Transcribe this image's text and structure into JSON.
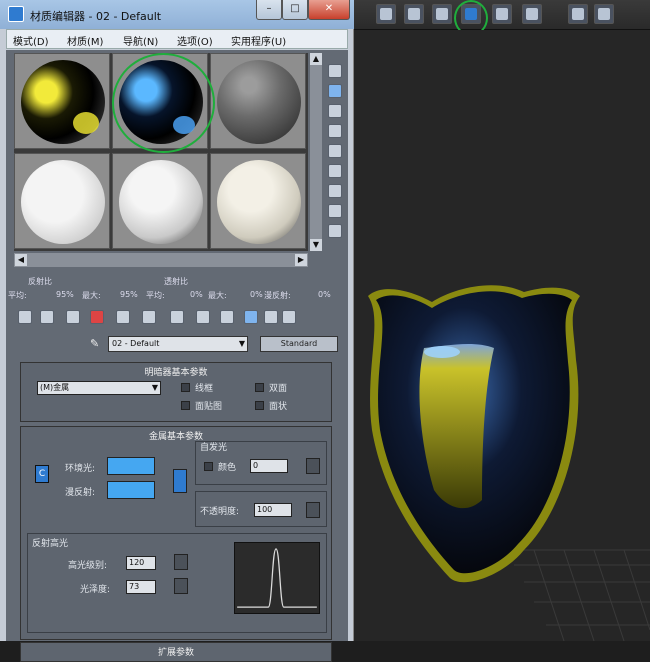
{
  "window": {
    "title": "材质编辑器 - 02 - Default",
    "minimize_label": "–",
    "maximize_label": "□",
    "close_label": "✕"
  },
  "menu": [
    {
      "label": "模式(D)"
    },
    {
      "label": "材质(M)"
    },
    {
      "label": "导航(N)"
    },
    {
      "label": "选项(O)"
    },
    {
      "label": "实用程序(U)"
    }
  ],
  "sample_slots": [
    {
      "material": "yellow-metal",
      "selected": false
    },
    {
      "material": "blue-metal",
      "selected": true
    },
    {
      "material": "gray",
      "selected": false
    },
    {
      "material": "white-glossy",
      "selected": false
    },
    {
      "material": "white-matte",
      "selected": false
    },
    {
      "material": "ivory",
      "selected": false
    }
  ],
  "params": {
    "reflect_label": "反射比",
    "refract_label": "透射比",
    "avg_label": "平均:",
    "max_label": "最大:",
    "reflect_avg": "95%",
    "reflect_max": "95%",
    "refract_avg": "0%",
    "refract_max": "0%",
    "diffuse_label": "漫反射:",
    "diffuse_value": "0%"
  },
  "material_row": {
    "material_name": "02 - Default",
    "type_button": "Standard"
  },
  "shader_panel": {
    "title": "明暗器基本参数",
    "shader": "(M)金属",
    "wire": "线框",
    "two_sided": "双面",
    "face_map": "面贴图",
    "faceted": "面状"
  },
  "metal_panel": {
    "title": "金属基本参数",
    "ambient": "环境光:",
    "diffuse": "漫反射:",
    "lock": "C",
    "self_illum": "自发光",
    "color": "颜色",
    "color_value": "0",
    "opacity": "不透明度:",
    "opacity_value": "100",
    "swatch_color": "#45a7f1"
  },
  "specular_panel": {
    "title": "反射高光",
    "level_label": "高光级别:",
    "level_value": "120",
    "gloss_label": "光泽度:",
    "gloss_value": "73"
  },
  "bottom_panel": {
    "title": "扩展参数"
  },
  "toolbar_icons": [
    "view-icon",
    "shade-icon",
    "render-icon",
    "material-editor-icon",
    "teapot-icon",
    "scene-icon",
    "frame-icon"
  ]
}
